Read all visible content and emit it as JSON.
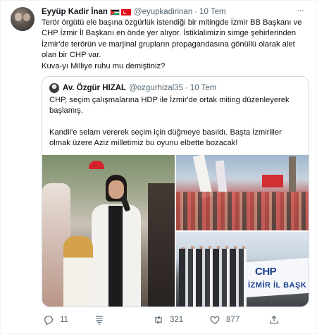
{
  "tweet": {
    "author_name": "Eyyüp Kadir İnan",
    "handle": "@eyupkadirinan",
    "separator": "·",
    "time": "10 Tem",
    "more_label": "···",
    "text_lines": [
      "Terör örgütü ele başına özgürlük istendiği bir mitingde İzmir BB Başkanı ve",
      "CHP İzmir İl Başkanı en önde yer alıyor. İstiklalimizin simge şehirlerinden",
      "İzmir'de terörün ve marjinal grupların propagandasına gönüllü olarak alet",
      "olan bir CHP var.",
      "Kuva-yı Milliye ruhu mu demiştiniz?"
    ]
  },
  "quote": {
    "author_name": "Av. Özgür HIZAL",
    "handle": "@ozgurhizal35",
    "separator": "·",
    "time": "10 Tem",
    "paragraph1_lines": [
      "CHP, seçim çalışmalarına HDP ile İzmir'de ortak miting düzenleyerek",
      "başlamış."
    ],
    "paragraph2_lines": [
      "Kandil'e selam vererek seçim için düğmeye basıldı. Başta İzmirliler",
      "olmak üzere Aziz milletimiz bu oyunu elbette bozacak!"
    ],
    "media": {
      "banner_text_1": "CHP",
      "banner_text_2": "İZMİR İL BAŞK"
    }
  },
  "actions": {
    "reply_count": "11",
    "retweet_count": "321",
    "like_count": "877",
    "icons": [
      "reply-icon",
      "bookmark-icon",
      "retweet-icon",
      "like-icon",
      "share-icon"
    ]
  },
  "colors": {
    "text": "#0f1419",
    "secondary": "#536471",
    "border": "#cfd9de"
  }
}
